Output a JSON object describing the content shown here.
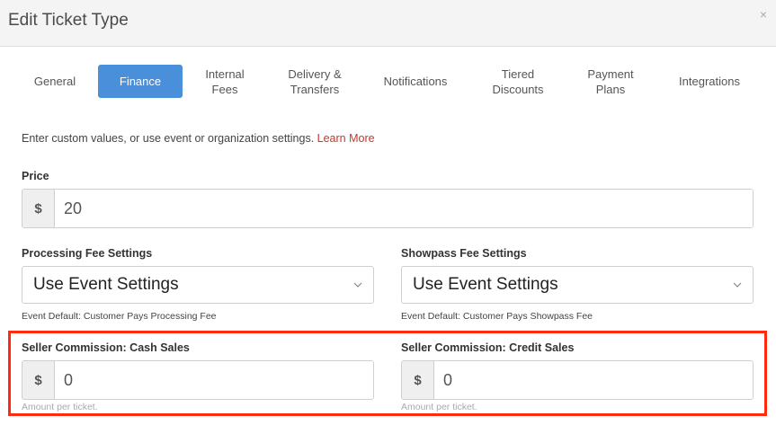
{
  "modal": {
    "title": "Edit Ticket Type",
    "close_glyph": "×"
  },
  "tabs": [
    {
      "label": "General"
    },
    {
      "label": "Finance",
      "active": true
    },
    {
      "label": "Internal\nFees"
    },
    {
      "label": "Delivery &\nTransfers"
    },
    {
      "label": "Notifications"
    },
    {
      "label": "Tiered\nDiscounts"
    },
    {
      "label": "Payment\nPlans"
    },
    {
      "label": "Integrations"
    }
  ],
  "intro": {
    "text": "Enter custom values, or use event or organization settings.",
    "link": "Learn More"
  },
  "price": {
    "label": "Price",
    "currency": "$",
    "value": "20"
  },
  "processing_fee": {
    "label": "Processing Fee Settings",
    "value": "Use Event Settings",
    "help": "Event Default: Customer Pays Processing Fee"
  },
  "showpass_fee": {
    "label": "Showpass Fee Settings",
    "value": "Use Event Settings",
    "help": "Event Default: Customer Pays Showpass Fee"
  },
  "cash_commission": {
    "label": "Seller Commission: Cash Sales",
    "currency": "$",
    "value": "0",
    "help": "Amount per ticket."
  },
  "credit_commission": {
    "label": "Seller Commission: Credit Sales",
    "currency": "$",
    "value": "0",
    "help": "Amount per ticket."
  },
  "colors": {
    "accent": "#4a8fd9",
    "link": "#c0392b",
    "highlight": "#ff2a10"
  }
}
